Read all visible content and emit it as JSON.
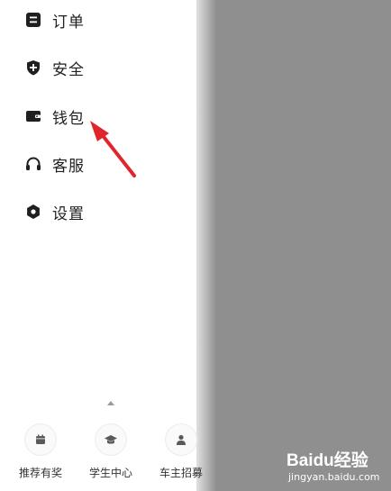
{
  "menu": {
    "items": [
      {
        "label": "订单",
        "icon": "order-icon"
      },
      {
        "label": "安全",
        "icon": "shield-icon"
      },
      {
        "label": "钱包",
        "icon": "wallet-icon"
      },
      {
        "label": "客服",
        "icon": "headset-icon"
      },
      {
        "label": "设置",
        "icon": "gear-icon"
      }
    ]
  },
  "bottom": {
    "items": [
      {
        "label": "推荐有奖",
        "icon": "calendar-icon"
      },
      {
        "label": "学生中心",
        "icon": "graduation-cap-icon"
      },
      {
        "label": "车主招募",
        "icon": "driver-icon"
      }
    ]
  },
  "watermark": {
    "main": "Baidu经验",
    "sub": "jingyan.baidu.com"
  },
  "colors": {
    "annotation_arrow": "#e0262a",
    "text": "#1f1f1f",
    "overlay": "#8f8f8f"
  }
}
